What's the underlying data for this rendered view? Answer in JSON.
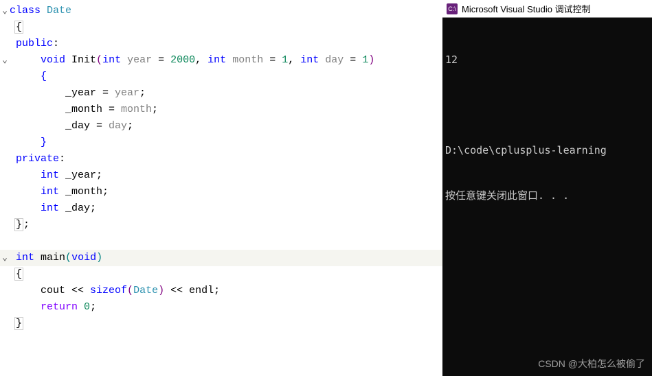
{
  "editor": {
    "lines": [
      {
        "g": "v",
        "html": "<span class='kw-class'>class</span> <span class='classname'>Date</span>"
      },
      {
        "g": "",
        "html": " <span class='outline'>{</span>"
      },
      {
        "g": "",
        "html": " <span class='kw-access'>public</span>:"
      },
      {
        "g": "v",
        "html": "     <span class='kw-void'>void</span> Init<span class='bracket-p'>(</span><span class='kw-type'>int</span> <span class='param'>year</span> = <span class='number'>2000</span>, <span class='kw-type'>int</span> <span class='param'>month</span> = <span class='number'>1</span>, <span class='kw-type'>int</span> <span class='param'>day</span> = <span class='number'>1</span><span class='bracket-p'>)</span>"
      },
      {
        "g": "",
        "html": "     <span class='bracket-b'>{</span>"
      },
      {
        "g": "",
        "html": "         _year = <span class='param'>year</span>;"
      },
      {
        "g": "",
        "html": "         _month = <span class='param'>month</span>;"
      },
      {
        "g": "",
        "html": "         _day = <span class='param'>day</span>;"
      },
      {
        "g": "",
        "html": "     <span class='bracket-b'>}</span>"
      },
      {
        "g": "",
        "html": " <span class='kw-access'>private</span>:"
      },
      {
        "g": "",
        "html": "     <span class='kw-type'>int</span> _year;"
      },
      {
        "g": "",
        "html": "     <span class='kw-type'>int</span> _month;"
      },
      {
        "g": "",
        "html": "     <span class='kw-type'>int</span> _day;"
      },
      {
        "g": "",
        "html": " <span class='outline'>}</span>;"
      },
      {
        "g": "",
        "html": ""
      },
      {
        "g": "v",
        "html": " <span class='kw-type'>int</span> main<span class='bracket-o'>(</span><span class='kw-type'>void</span><span class='bracket-o'>)</span>",
        "hl": true
      },
      {
        "g": "",
        "html": " <span class='outline'>{</span>"
      },
      {
        "g": "",
        "html": "     cout &lt;&lt; <span class='kw-sizeof'>sizeof</span><span class='bracket-p'>(</span><span class='classname'>Date</span><span class='bracket-p'>)</span> &lt;&lt; endl;"
      },
      {
        "g": "",
        "html": "     <span class='kw-return'>return</span> <span class='number'>0</span>;"
      },
      {
        "g": "",
        "html": " <span class='outline'>}</span>"
      }
    ]
  },
  "console": {
    "title": "Microsoft Visual Studio 调试控制",
    "icon_text": "C:\\",
    "output_value": "12",
    "output_path": "D:\\code\\cplusplus-learning",
    "prompt": "按任意键关闭此窗口. . ."
  },
  "watermark": "CSDN @大柏怎么被偷了"
}
